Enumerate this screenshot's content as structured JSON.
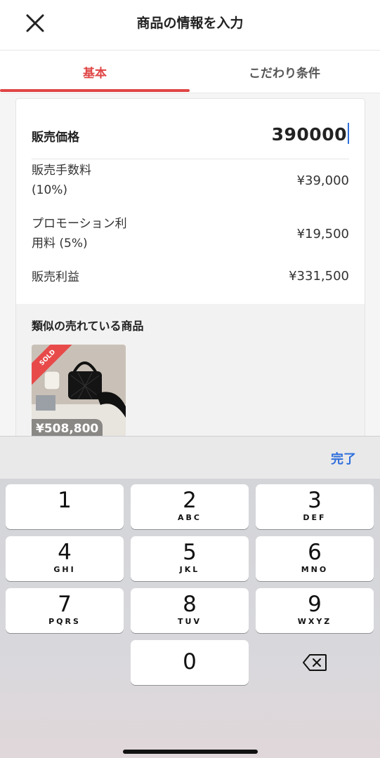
{
  "header": {
    "title": "商品の情報を入力",
    "close_icon": "close-icon"
  },
  "tabs": [
    {
      "label": "基本",
      "active": true
    },
    {
      "label": "こだわり条件",
      "active": false
    }
  ],
  "price": {
    "label": "販売価格",
    "value": "390000"
  },
  "fees": [
    {
      "label_line1": "販売手数料",
      "label_line2": "(10%)",
      "value": "¥39,000"
    },
    {
      "label_line1": "プロモーション利",
      "label_line2": "用料 (5%)",
      "value": "¥19,500"
    },
    {
      "label_line1": "販売利益",
      "label_line2": "",
      "value": "¥331,500"
    }
  ],
  "similar": {
    "title": "類似の売れている商品",
    "items": [
      {
        "badge": "SOLD",
        "price": "¥508,800"
      }
    ]
  },
  "keyboard": {
    "done_label": "完了",
    "keys": [
      {
        "num": "1",
        "letters": ""
      },
      {
        "num": "2",
        "letters": "ABC"
      },
      {
        "num": "3",
        "letters": "DEF"
      },
      {
        "num": "4",
        "letters": "GHI"
      },
      {
        "num": "5",
        "letters": "JKL"
      },
      {
        "num": "6",
        "letters": "MNO"
      },
      {
        "num": "7",
        "letters": "PQRS"
      },
      {
        "num": "8",
        "letters": "TUV"
      },
      {
        "num": "9",
        "letters": "WXYZ"
      },
      {
        "num": "0",
        "letters": ""
      }
    ],
    "delete_icon": "backspace-icon"
  },
  "colors": {
    "accent": "#e04545",
    "link": "#2f6fdc"
  }
}
